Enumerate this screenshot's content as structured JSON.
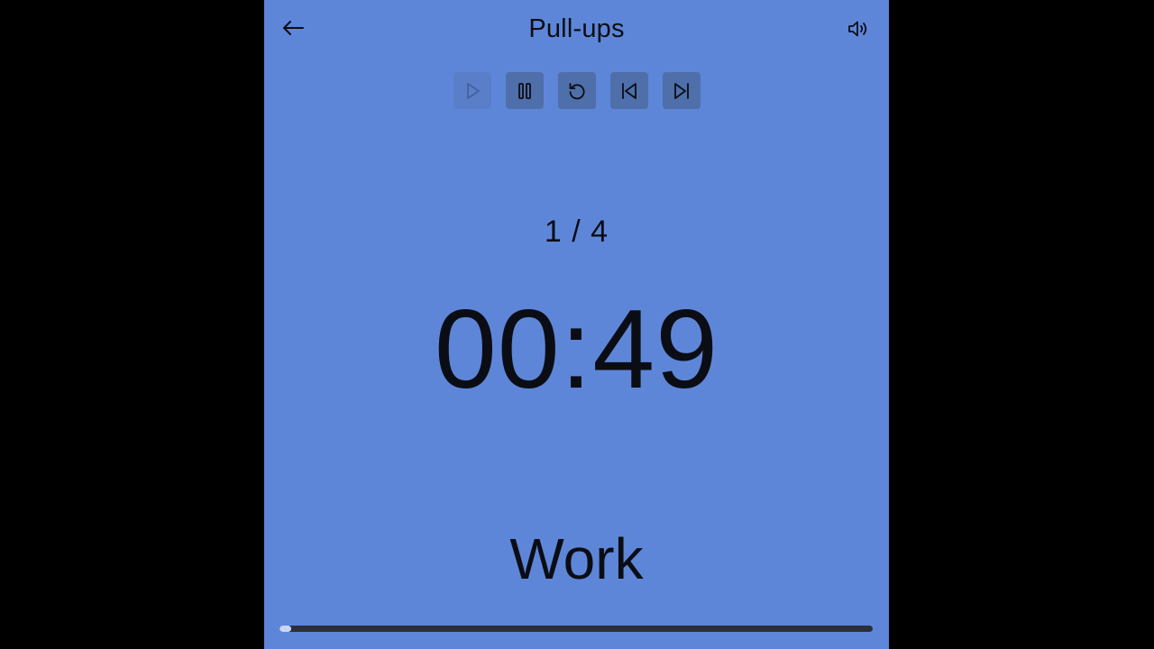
{
  "header": {
    "title": "Pull-ups",
    "back_icon": "arrow-left-icon",
    "sound_icon": "speaker-icon"
  },
  "controls": [
    {
      "name": "play",
      "icon": "play-icon",
      "enabled": false
    },
    {
      "name": "pause",
      "icon": "pause-icon",
      "enabled": true
    },
    {
      "name": "restart",
      "icon": "restart-icon",
      "enabled": true
    },
    {
      "name": "previous",
      "icon": "skip-previous-icon",
      "enabled": true
    },
    {
      "name": "next",
      "icon": "skip-next-icon",
      "enabled": true
    }
  ],
  "workout": {
    "round": "1 / 4",
    "time": "00:49",
    "phase": "Work",
    "progress_percent": 2
  },
  "colors": {
    "background": "#5e86d8",
    "button": "#4e6fa9",
    "text": "#0b0d14",
    "progress_track": "#2b2f38",
    "progress_fill": "#c7d6f2",
    "outside": "#000000"
  }
}
